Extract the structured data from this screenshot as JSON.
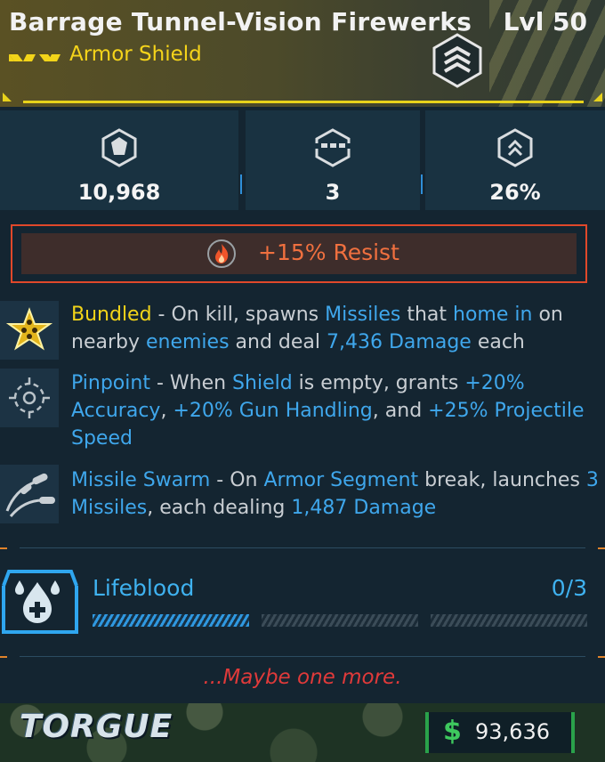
{
  "item": {
    "name": "Barrage Tunnel-Vision Firewerks",
    "level": "Lvl 50",
    "type": "Armor Shield",
    "rarity_icon": "rarity-chevrons-icon",
    "emblem_icon": "armor-shield-emblem-icon"
  },
  "stats": [
    {
      "icon": "shield-capacity-icon",
      "value": "10,968"
    },
    {
      "icon": "armor-segments-icon",
      "value": "3"
    },
    {
      "icon": "recharge-rate-icon",
      "value": "26%"
    }
  ],
  "resist": {
    "icon": "fire-icon",
    "text": "+15% Resist"
  },
  "perks": [
    {
      "icon": "bundled-star-icon",
      "name": "Bundled",
      "parts": [
        " - On kill, spawns ",
        "Missiles",
        " that ",
        "home in",
        " on nearby ",
        "enemies",
        " and deal ",
        "7,436 Damage",
        " each"
      ]
    },
    {
      "icon": "pinpoint-crosshair-icon",
      "name": "Pinpoint",
      "parts": [
        " - When ",
        "Shield",
        " is empty, grants ",
        "+20% Accuracy",
        ", ",
        "+20% Gun Handling",
        ", and ",
        "+25% Projectile Speed"
      ]
    },
    {
      "icon": "missile-swarm-icon",
      "name": "Missile Swarm",
      "parts": [
        " - On ",
        "Armor Segment",
        " break, launches ",
        "3 Missiles",
        ", each dealing ",
        "1,487 Damage"
      ]
    }
  ],
  "lifeblood": {
    "label": "Lifeblood",
    "count": "0/3",
    "progress": 0.33,
    "icon": "blood-drop-icon"
  },
  "flavor": "...Maybe one more.",
  "manufacturer": "TORGUE",
  "price": {
    "symbol": "$",
    "amount": "93,636"
  },
  "colors": {
    "legendary_yellow": "#f2d419",
    "highlight_blue": "#3fa7ec",
    "fire_orange": "#f0703f",
    "money_green": "#3ec85e"
  }
}
